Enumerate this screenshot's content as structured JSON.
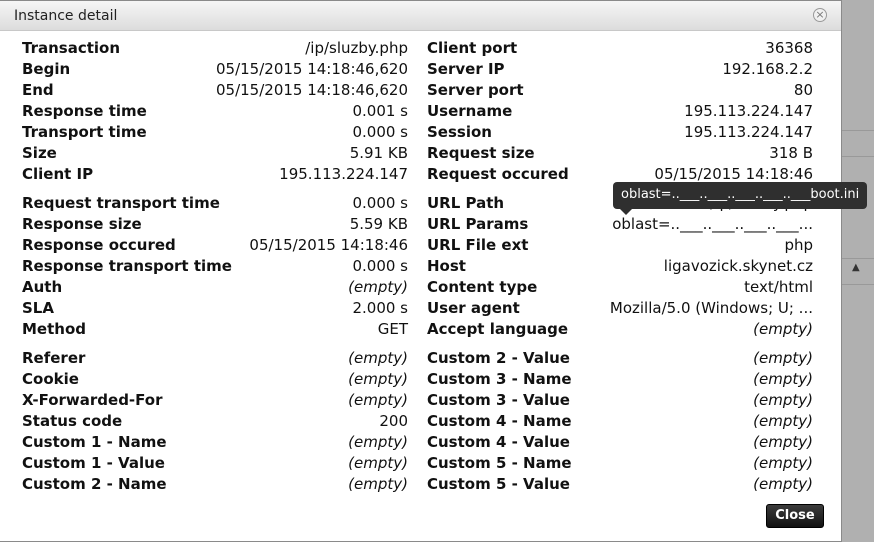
{
  "dialog": {
    "title": "Instance detail",
    "close_icon": "close-circle-icon",
    "close_button": "Close"
  },
  "tooltip": "oblast=..___..___..___..___..___boot.ini",
  "left_groups": [
    [
      {
        "k": "Transaction",
        "v": "/ip/sluzby.php"
      },
      {
        "k": "Begin",
        "v": "05/15/2015 14:18:46,620"
      },
      {
        "k": "End",
        "v": "05/15/2015 14:18:46,620"
      },
      {
        "k": "Response time",
        "v": "0.001 s"
      },
      {
        "k": "Transport time",
        "v": "0.000 s"
      },
      {
        "k": "Size",
        "v": "5.91 KB"
      },
      {
        "k": "Client IP",
        "v": "195.113.224.147"
      }
    ],
    [
      {
        "k": "Request transport time",
        "v": "0.000 s"
      },
      {
        "k": "Response size",
        "v": "5.59 KB"
      },
      {
        "k": "Response occured",
        "v": "05/15/2015 14:18:46"
      },
      {
        "k": "Response transport time",
        "v": "0.000 s"
      },
      {
        "k": "Auth",
        "v": "(empty)"
      },
      {
        "k": "SLA",
        "v": "2.000 s"
      },
      {
        "k": "Method",
        "v": "GET"
      }
    ],
    [
      {
        "k": "Referer",
        "v": "(empty)"
      },
      {
        "k": "Cookie",
        "v": "(empty)"
      },
      {
        "k": "X-Forwarded-For",
        "v": "(empty)"
      },
      {
        "k": "Status code",
        "v": "200"
      },
      {
        "k": "Custom 1 - Name",
        "v": "(empty)"
      },
      {
        "k": "Custom 1 - Value",
        "v": "(empty)"
      },
      {
        "k": "Custom 2 - Name",
        "v": "(empty)"
      }
    ]
  ],
  "right_groups": [
    [
      {
        "k": "Client port",
        "v": "36368"
      },
      {
        "k": "Server IP",
        "v": "192.168.2.2"
      },
      {
        "k": "Server port",
        "v": "80"
      },
      {
        "k": "Username",
        "v": "195.113.224.147"
      },
      {
        "k": "Session",
        "v": "195.113.224.147"
      },
      {
        "k": "Request size",
        "v": "318 B"
      },
      {
        "k": "Request occured",
        "v": "05/15/2015 14:18:46"
      }
    ],
    [
      {
        "k": "URL Path",
        "v": "/ip/sluzby.php"
      },
      {
        "k": "URL Params",
        "v": "oblast=..___..___..___..___..."
      },
      {
        "k": "URL File ext",
        "v": "php"
      },
      {
        "k": "Host",
        "v": "ligavozick.skynet.cz"
      },
      {
        "k": "Content type",
        "v": "text/html"
      },
      {
        "k": "User agent",
        "v": "Mozilla/5.0 (Windows; U; ..."
      },
      {
        "k": "Accept language",
        "v": "(empty)"
      }
    ],
    [
      {
        "k": "Custom 2 - Value",
        "v": "(empty)"
      },
      {
        "k": "Custom 3 - Name",
        "v": "(empty)"
      },
      {
        "k": "Custom 3 - Value",
        "v": "(empty)"
      },
      {
        "k": "Custom 4 - Name",
        "v": "(empty)"
      },
      {
        "k": "Custom 4 - Value",
        "v": "(empty)"
      },
      {
        "k": "Custom 5 - Name",
        "v": "(empty)"
      },
      {
        "k": "Custom 5 - Value",
        "v": "(empty)"
      }
    ]
  ]
}
